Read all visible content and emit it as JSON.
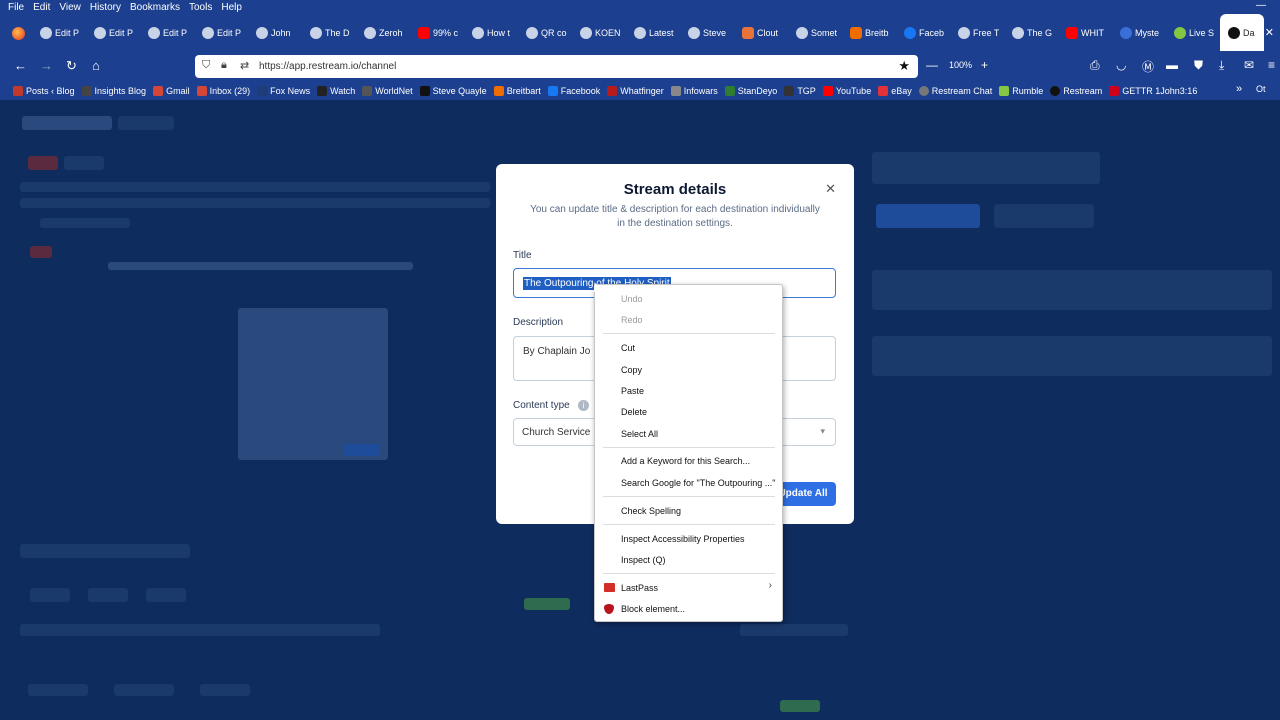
{
  "browser": {
    "menu": [
      "File",
      "Edit",
      "View",
      "History",
      "Bookmarks",
      "Tools",
      "Help"
    ],
    "minimize_icon": "minimize-icon",
    "tabs": [
      {
        "label": "Edit P",
        "icon": "tab-favicon"
      },
      {
        "label": "Edit P",
        "icon": "tab-favicon"
      },
      {
        "label": "Edit P",
        "icon": "tab-favicon"
      },
      {
        "label": "Edit P",
        "icon": "tab-favicon"
      },
      {
        "label": "John",
        "icon": "tab-favicon"
      },
      {
        "label": "The D",
        "icon": "tab-favicon"
      },
      {
        "label": "Zeroh",
        "icon": "tab-favicon"
      },
      {
        "label": "99% c",
        "icon": "youtube-icon"
      },
      {
        "label": "How t",
        "icon": "tab-favicon"
      },
      {
        "label": "QR co",
        "icon": "tab-favicon"
      },
      {
        "label": "KOEN",
        "icon": "tab-favicon"
      },
      {
        "label": "Latest",
        "icon": "tab-favicon"
      },
      {
        "label": "Steve",
        "icon": "tab-favicon"
      },
      {
        "label": "Clout",
        "icon": "tab-favicon"
      },
      {
        "label": "Somet",
        "icon": "tab-favicon"
      },
      {
        "label": "Breitb",
        "icon": "tab-favicon"
      },
      {
        "label": "Faceb",
        "icon": "facebook-icon"
      },
      {
        "label": "Free T",
        "icon": "tab-favicon"
      },
      {
        "label": "The G",
        "icon": "tab-favicon"
      },
      {
        "label": "WHIT",
        "icon": "youtube-icon"
      },
      {
        "label": "Myste",
        "icon": "tab-favicon"
      },
      {
        "label": "Live S",
        "icon": "tab-favicon"
      },
      {
        "label": "Da",
        "icon": "tab-favicon",
        "active": true
      }
    ],
    "tab_close": "✕",
    "url": "https://app.restream.io/channel",
    "zoom": "100%",
    "zoom_minus": "—",
    "zoom_plus": "+",
    "bookmarks": [
      {
        "label": "Posts ‹ Blog",
        "color": "#c0392b"
      },
      {
        "label": "Insights Blog",
        "color": "#444"
      },
      {
        "label": "Gmail",
        "color": "#d44638"
      },
      {
        "label": "Inbox (29)",
        "color": "#d44638"
      },
      {
        "label": "Fox News",
        "color": "#1d3c78"
      },
      {
        "label": "Watch",
        "color": "#222"
      },
      {
        "label": "WorldNet",
        "color": "#555"
      },
      {
        "label": "Steve Quayle",
        "color": "#111"
      },
      {
        "label": "Breitbart",
        "color": "#ef6c00"
      },
      {
        "label": "Facebook",
        "color": "#1877f2"
      },
      {
        "label": "Whatfinger",
        "color": "#b71c1c"
      },
      {
        "label": "Infowars",
        "color": "#888"
      },
      {
        "label": "StanDeyo",
        "color": "#2e7d32"
      },
      {
        "label": "TGP",
        "color": "#333"
      },
      {
        "label": "YouTube",
        "color": "#ff0000"
      },
      {
        "label": "eBay",
        "color": "#e53238"
      },
      {
        "label": "Restream Chat",
        "color": "#777"
      },
      {
        "label": "Rumble",
        "color": "#85c742"
      },
      {
        "label": "Restream",
        "color": "#111"
      },
      {
        "label": "GETTR 1John3:16",
        "color": "#d0021b"
      }
    ],
    "bookmarks_overflow": "»",
    "other_bookmarks": "Ot"
  },
  "modal": {
    "title": "Stream details",
    "subtitle": "You can update title & description for each destination individually in the destination settings.",
    "close": "✕",
    "title_label": "Title",
    "title_value": "The Outpouring of the Holy Spirit",
    "description_label": "Description",
    "description_value": "By Chaplain Jo",
    "content_type_label": "Content type",
    "content_type_value": "Church Service",
    "content_type_chevron": "▾",
    "info_icon": "i",
    "update_button": "Update All",
    "update_button_visible": "pdate All"
  },
  "context_menu": {
    "items": [
      {
        "label": "Undo",
        "disabled": true
      },
      {
        "label": "Redo",
        "disabled": true
      },
      {
        "label": "Cut"
      },
      {
        "label": "Copy"
      },
      {
        "label": "Paste"
      },
      {
        "label": "Delete"
      },
      {
        "label": "Select All"
      },
      {
        "label": "Add a Keyword for this Search..."
      },
      {
        "label": "Search Google for \"The Outpouring ...\""
      },
      {
        "label": "Check Spelling"
      },
      {
        "label": "Inspect Accessibility Properties"
      },
      {
        "label": "Inspect (Q)"
      },
      {
        "label": "LastPass",
        "icon": "lastpass-icon",
        "submenu": true
      },
      {
        "label": "Block element...",
        "icon": "ublock-shield-icon"
      }
    ],
    "submenu_arrow": "›"
  }
}
